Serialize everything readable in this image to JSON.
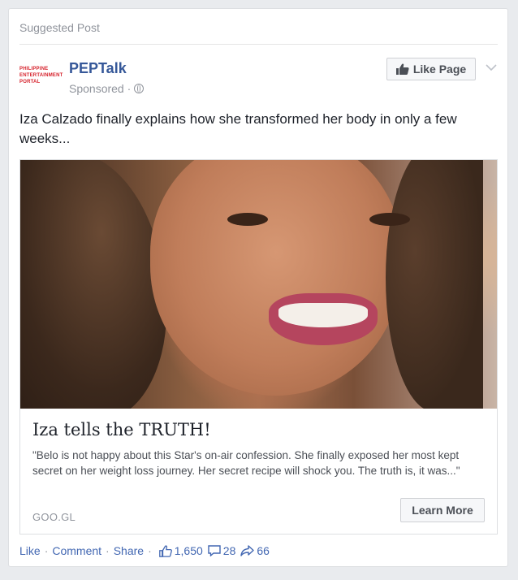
{
  "header_label": "Suggested Post",
  "page": {
    "logo_lines": [
      "PHILIPPINE",
      "ENTERTAINMENT",
      "PORTAL"
    ],
    "name": "PEPTalk",
    "sponsored": "Sponsored ·",
    "like_page_label": "Like Page"
  },
  "post": {
    "text": "Iza Calzado finally explains how she transformed her body in only a few weeks..."
  },
  "link": {
    "title": "Iza tells the TRUTH!",
    "description": "\"Belo is not happy about this Star's on-air confession. She finally exposed her most kept secret on her weight loss journey. Her secret recipe will shock you. The truth is, it was...\"",
    "domain": "GOO.GL",
    "button_label": "Learn More"
  },
  "actions": {
    "like": "Like",
    "comment": "Comment",
    "share": "Share",
    "likes_count": "1,650",
    "comments_count": "28",
    "shares_count": "66"
  },
  "colors": {
    "link_blue": "#4267b2",
    "name_blue": "#365899",
    "brand_red": "#d6212b"
  }
}
